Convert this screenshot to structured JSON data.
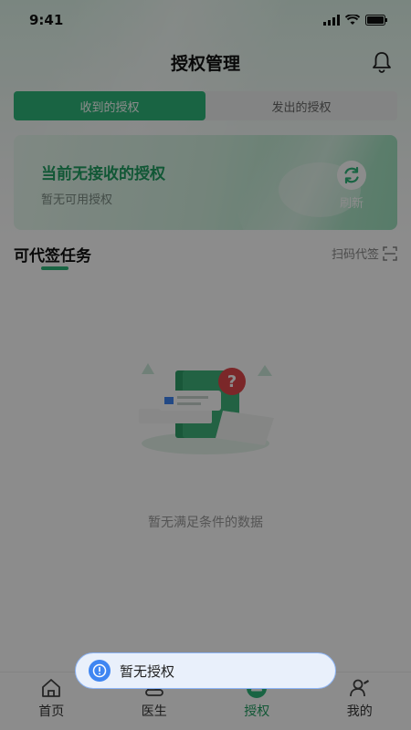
{
  "status": {
    "time": "9:41"
  },
  "header": {
    "title": "授权管理"
  },
  "tabs": [
    {
      "label": "收到的授权",
      "active": true
    },
    {
      "label": "发出的授权",
      "active": false
    }
  ],
  "card": {
    "title": "当前无接收的授权",
    "subtitle": "暂无可用授权",
    "refresh_label": "刷新"
  },
  "section": {
    "title": "可代签任务",
    "scan_label": "扫码代签"
  },
  "empty": {
    "text": "暂无满足条件的数据"
  },
  "tabbar": [
    {
      "label": "首页",
      "icon": "home-icon"
    },
    {
      "label": "医生",
      "icon": "stethoscope-icon"
    },
    {
      "label": "授权",
      "icon": "authorize-icon",
      "active": true
    },
    {
      "label": "我的",
      "icon": "user-icon"
    }
  ],
  "toast": {
    "text": "暂无授权"
  },
  "colors": {
    "accent": "#2fb77a",
    "toast_blue": "#3f86f2"
  }
}
